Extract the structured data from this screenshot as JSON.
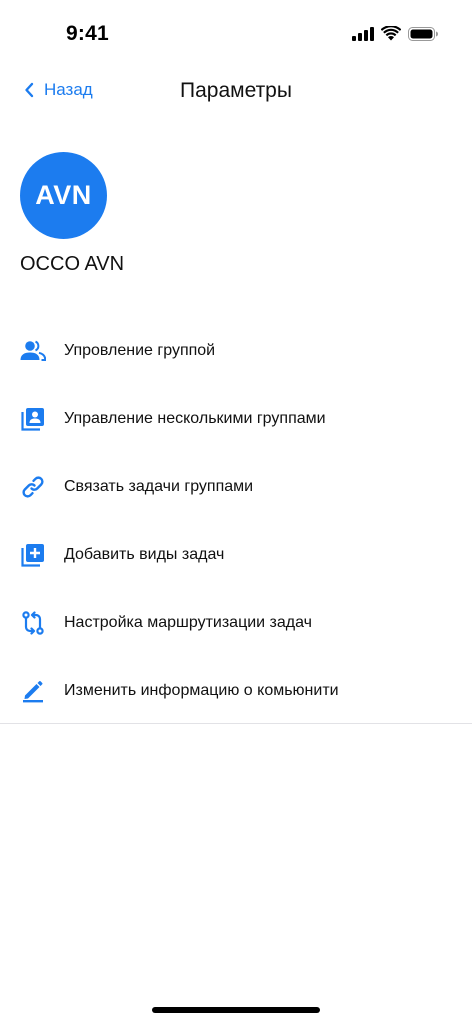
{
  "status_bar": {
    "time": "9:41"
  },
  "nav": {
    "back_label": "Назад",
    "title": "Параметры"
  },
  "profile": {
    "initials": "AVN",
    "name": "OCCO AVN"
  },
  "menu": {
    "items": [
      {
        "label": "Упровление группой",
        "icon": "people-icon"
      },
      {
        "label": "Управление несколькими группами",
        "icon": "contacts-icon"
      },
      {
        "label": "Связать задачи группами",
        "icon": "link-icon"
      },
      {
        "label": "Добавить виды задач",
        "icon": "add-box-icon"
      },
      {
        "label": "Настройка маршрутизации задач",
        "icon": "routing-icon"
      },
      {
        "label": "Изменить информацию о комьюнити",
        "icon": "pencil-icon"
      }
    ]
  },
  "colors": {
    "accent": "#1c7cef",
    "text": "#111111",
    "divider": "#e2e2e6"
  }
}
